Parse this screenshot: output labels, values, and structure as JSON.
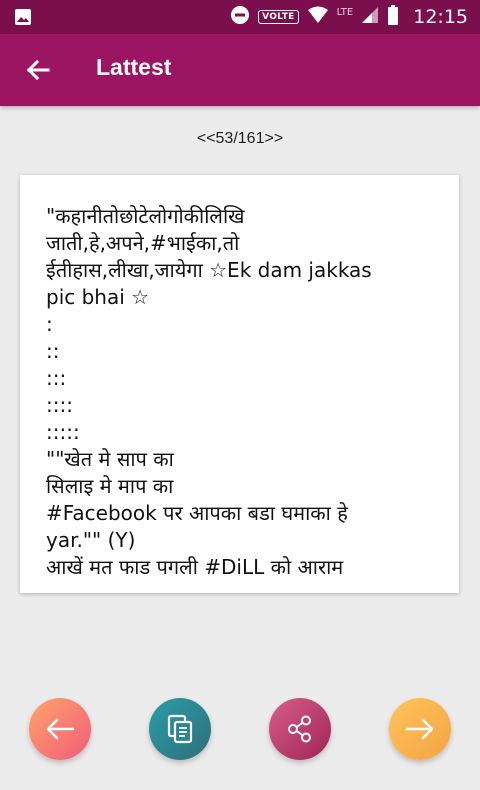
{
  "status_bar": {
    "volte": "VOLTE",
    "network": "LTE",
    "time": "12:15"
  },
  "app_bar": {
    "title": "Lattest"
  },
  "counter": "<<53/161>>",
  "content": {
    "text": "\"कहानीतोछोटेलोगोकीलिखि\nजाती,हे,अपने,#भाईका,तो\nईतीहास,लीखा,जायेगा ☆Ek dam jakkas\npic bhai ☆\n:\n::\n:::\n::::\n:::::\n\"\"खेत मे साप का\nसिलाइ मे माप का\n#Facebook पर आपका बडा घमाका हे\nyar.\"\" (Y)\nआखें मत फाड पगली #DiLL को आराम"
  },
  "icons": {
    "status_left": "image-icon",
    "back": "arrow-left-icon",
    "prev": "arrow-left-icon",
    "copy": "copy-icon",
    "share": "share-icon",
    "next": "arrow-right-icon"
  },
  "colors": {
    "status_bar": "#7b0e4c",
    "app_bar": "#9c1563",
    "prev_button": "#f8806f",
    "copy_button": "#2c8690",
    "share_button": "#bd3f70",
    "next_button": "#f7b44f"
  }
}
